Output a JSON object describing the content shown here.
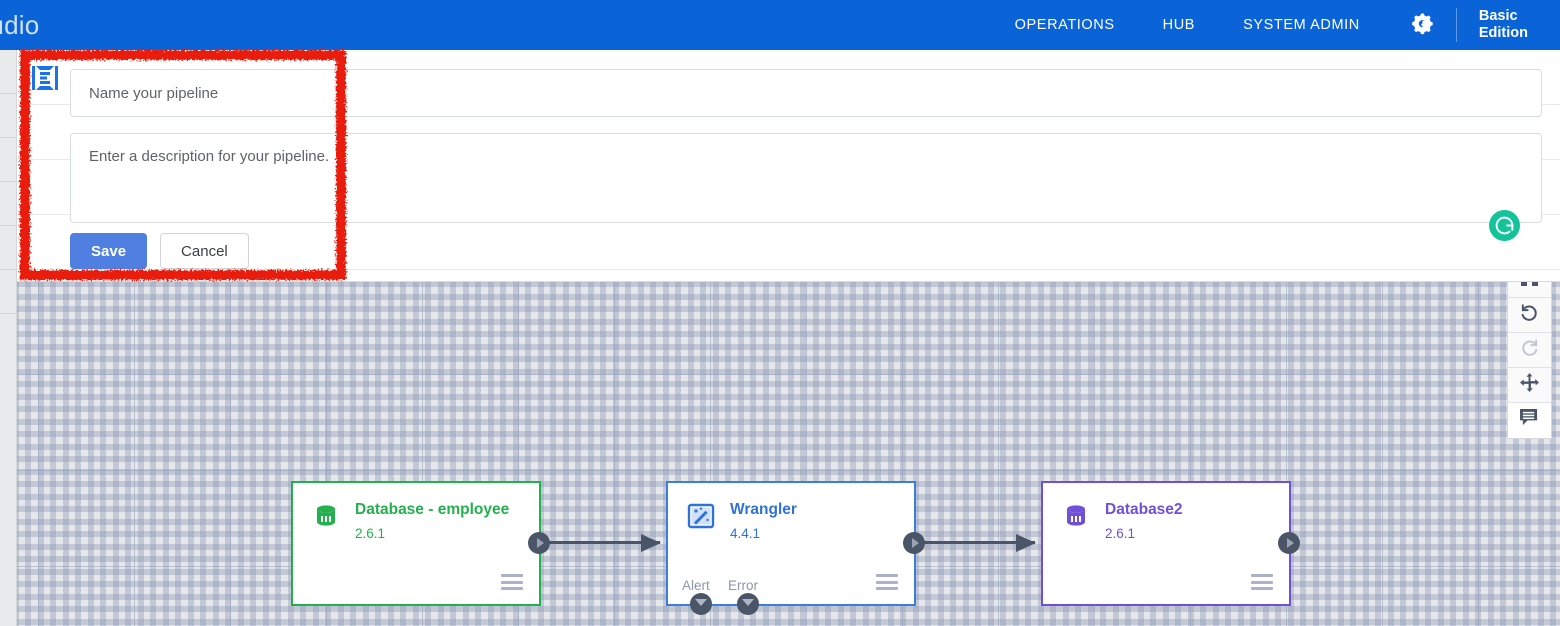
{
  "header": {
    "brand": "tudio",
    "nav": [
      {
        "label": "OPERATIONS"
      },
      {
        "label": "HUB"
      },
      {
        "label": "SYSTEM ADMIN"
      }
    ],
    "gear_icon": "gears-icon",
    "edition_line1": "Basic",
    "edition_line2": "Edition",
    "background_color": "#0a64d8"
  },
  "form": {
    "logo_icon": "pipeline-logo-icon",
    "name_placeholder": "Name your pipeline",
    "name_value": "",
    "description_placeholder": "Enter a description for your pipeline.",
    "description_value": "",
    "save_label": "Save",
    "cancel_label": "Cancel",
    "save_color": "#4f7fe0",
    "grammarly_icon": "grammarly-icon",
    "grammarly_color": "#15c39a"
  },
  "annotation": {
    "type": "hand-drawn-rectangle",
    "color": "#e81b0c"
  },
  "toolbar": {
    "buttons": [
      {
        "name": "fit-to-screen-button",
        "icon": "fit-screen-icon",
        "enabled": true
      },
      {
        "name": "undo-button",
        "icon": "undo-icon",
        "enabled": true
      },
      {
        "name": "redo-button",
        "icon": "redo-icon",
        "enabled": false
      },
      {
        "name": "pan-button",
        "icon": "move-arrows-icon",
        "enabled": true
      },
      {
        "name": "comment-button",
        "icon": "comment-icon",
        "enabled": true
      }
    ]
  },
  "canvas": {
    "nodes": [
      {
        "name": "Database - employee",
        "version": "2.6.1",
        "icon": "database-icon",
        "color": "#22b14c",
        "ports": {
          "output": true,
          "bottom": []
        }
      },
      {
        "name": "Wrangler",
        "version": "4.4.1",
        "icon": "wrangler-wand-icon",
        "color": "#2f72d8",
        "ports": {
          "output": true,
          "bottom": [
            "Alert",
            "Error"
          ]
        }
      },
      {
        "name": "Database2",
        "version": "2.6.1",
        "icon": "database-icon",
        "color": "#7150d8",
        "ports": {
          "output": true,
          "bottom": []
        }
      }
    ],
    "connections": [
      {
        "from": "Database - employee",
        "to": "Wrangler"
      },
      {
        "from": "Wrangler",
        "to": "Database2"
      }
    ]
  }
}
